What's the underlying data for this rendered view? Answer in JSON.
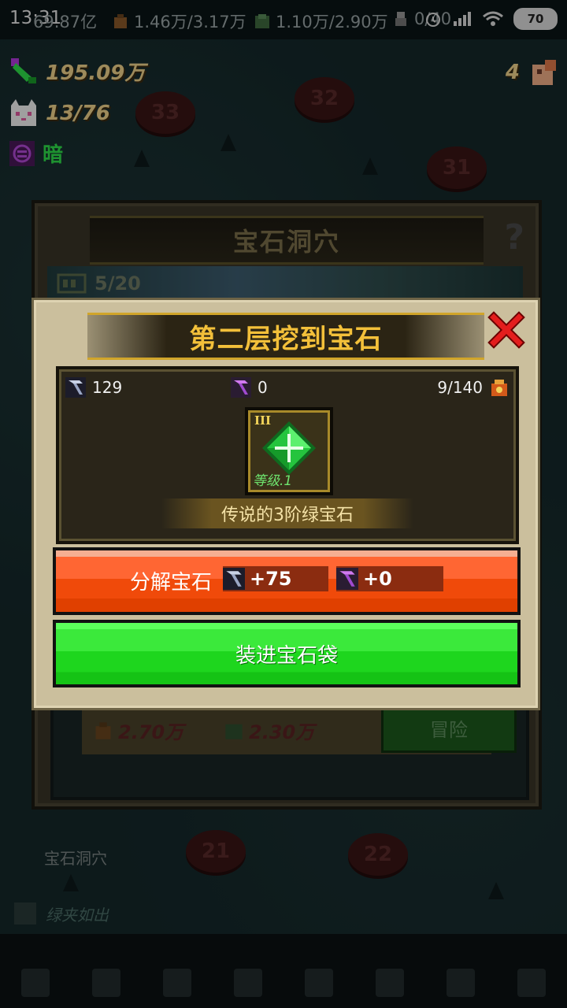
{
  "status_bar": {
    "time": "13:31",
    "res1_value": "69.87亿",
    "res2_value": "1.46万/3.17万",
    "res3_value": "1.10万/2.90万",
    "res4_value": "0/40",
    "right_value": "800",
    "battery": "70"
  },
  "hud": {
    "gems_value": "195.09万",
    "cat_value": "13/76",
    "element_label": "暗",
    "top_right_count": "4"
  },
  "background": {
    "level_nodes": [
      "33",
      "32",
      "31",
      "21",
      "22"
    ],
    "cave_title": "宝石洞穴",
    "help_symbol": "?",
    "energy": "5/20",
    "cost1": "2.70万",
    "cost2": "2.30万",
    "adventure_label": "冒险",
    "location_label": "宝石洞穴",
    "avatar_text": "绿夹如出"
  },
  "dialog": {
    "title": "第二层挖到宝石",
    "stats": {
      "hammer_count": "129",
      "purple_count": "0",
      "bag_capacity": "9/140"
    },
    "gem": {
      "tier": "III",
      "level": "等级.1",
      "name": "传说的3阶绿宝石",
      "color": "#2ee04a"
    },
    "decompose": {
      "label": "分解宝石",
      "reward_hammer": "+75",
      "reward_purple": "+0"
    },
    "store_label": "装进宝石袋"
  },
  "colors": {
    "title_gold": "#f3c03a",
    "decompose_orange": "#f04a0a",
    "store_green": "#1ed61e"
  }
}
